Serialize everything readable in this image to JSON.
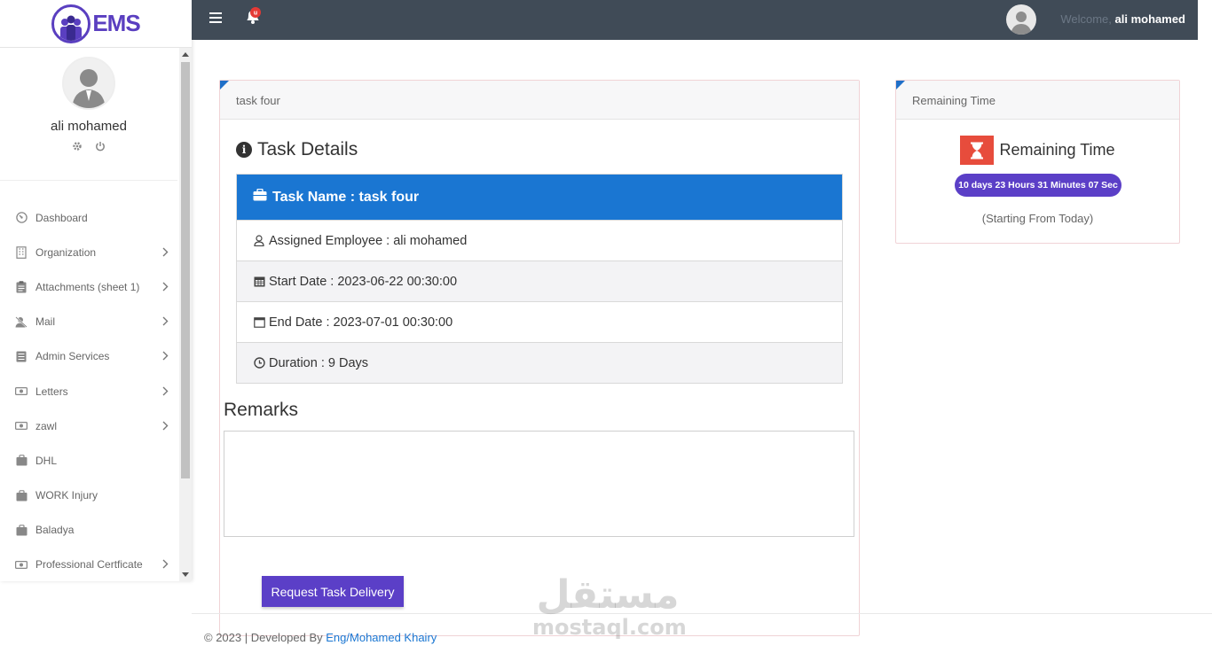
{
  "brand": {
    "logo_text": "EMS"
  },
  "topbar": {
    "welcome_prefix": "Welcome,",
    "user_name": "ali mohamed",
    "bell_badge": "u"
  },
  "sidebar": {
    "profile_name": "ali mohamed",
    "items": [
      {
        "label": "Dashboard",
        "icon": "gauge-icon",
        "has_submenu": false
      },
      {
        "label": "Organization",
        "icon": "building-icon",
        "has_submenu": true
      },
      {
        "label": "Attachments (sheet 1)",
        "icon": "clipboard-icon",
        "has_submenu": true
      },
      {
        "label": "Mail",
        "icon": "user-slash-icon",
        "has_submenu": true
      },
      {
        "label": "Admin Services",
        "icon": "list-icon",
        "has_submenu": true
      },
      {
        "label": "Letters",
        "icon": "money-icon",
        "has_submenu": true
      },
      {
        "label": "zawl",
        "icon": "money-icon",
        "has_submenu": true
      },
      {
        "label": "DHL",
        "icon": "briefcase-icon",
        "has_submenu": false
      },
      {
        "label": "WORK Injury",
        "icon": "briefcase-icon",
        "has_submenu": false
      },
      {
        "label": "Baladya",
        "icon": "briefcase-icon",
        "has_submenu": false
      },
      {
        "label": "Professional Certficate",
        "icon": "money-icon",
        "has_submenu": true
      }
    ]
  },
  "task_card": {
    "header": "task four",
    "section_title": "Task Details",
    "task_name": "Task Name : task four",
    "rows": [
      {
        "icon": "user-icon",
        "text": "Assigned Employee : ali mohamed"
      },
      {
        "icon": "calendar-icon",
        "text": "Start Date : 2023-06-22 00:30:00"
      },
      {
        "icon": "calendar-empty-icon",
        "text": "End Date : 2023-07-01 00:30:00"
      },
      {
        "icon": "clock-icon",
        "text": "Duration : 9 Days"
      }
    ],
    "remarks_title": "Remarks",
    "remarks_value": "",
    "request_button": "Request Task Delivery"
  },
  "time_card": {
    "header": "Remaining Time",
    "title": "Remaining Time",
    "countdown": "10 days 23 Hours 31 Minutes 07 Sec",
    "subtitle": "(Starting From Today)"
  },
  "footer": {
    "text": "© 2023 | Developed By ",
    "link": "Eng/Mohamed Khairy"
  },
  "watermark": {
    "arabic": "مستقل",
    "latin": "mostaql.com"
  },
  "colors": {
    "topbar": "#404b57",
    "primary_blue": "#1a76d2",
    "accent_purple": "#5b3fc7",
    "hourglass_red": "#e74c3c"
  }
}
